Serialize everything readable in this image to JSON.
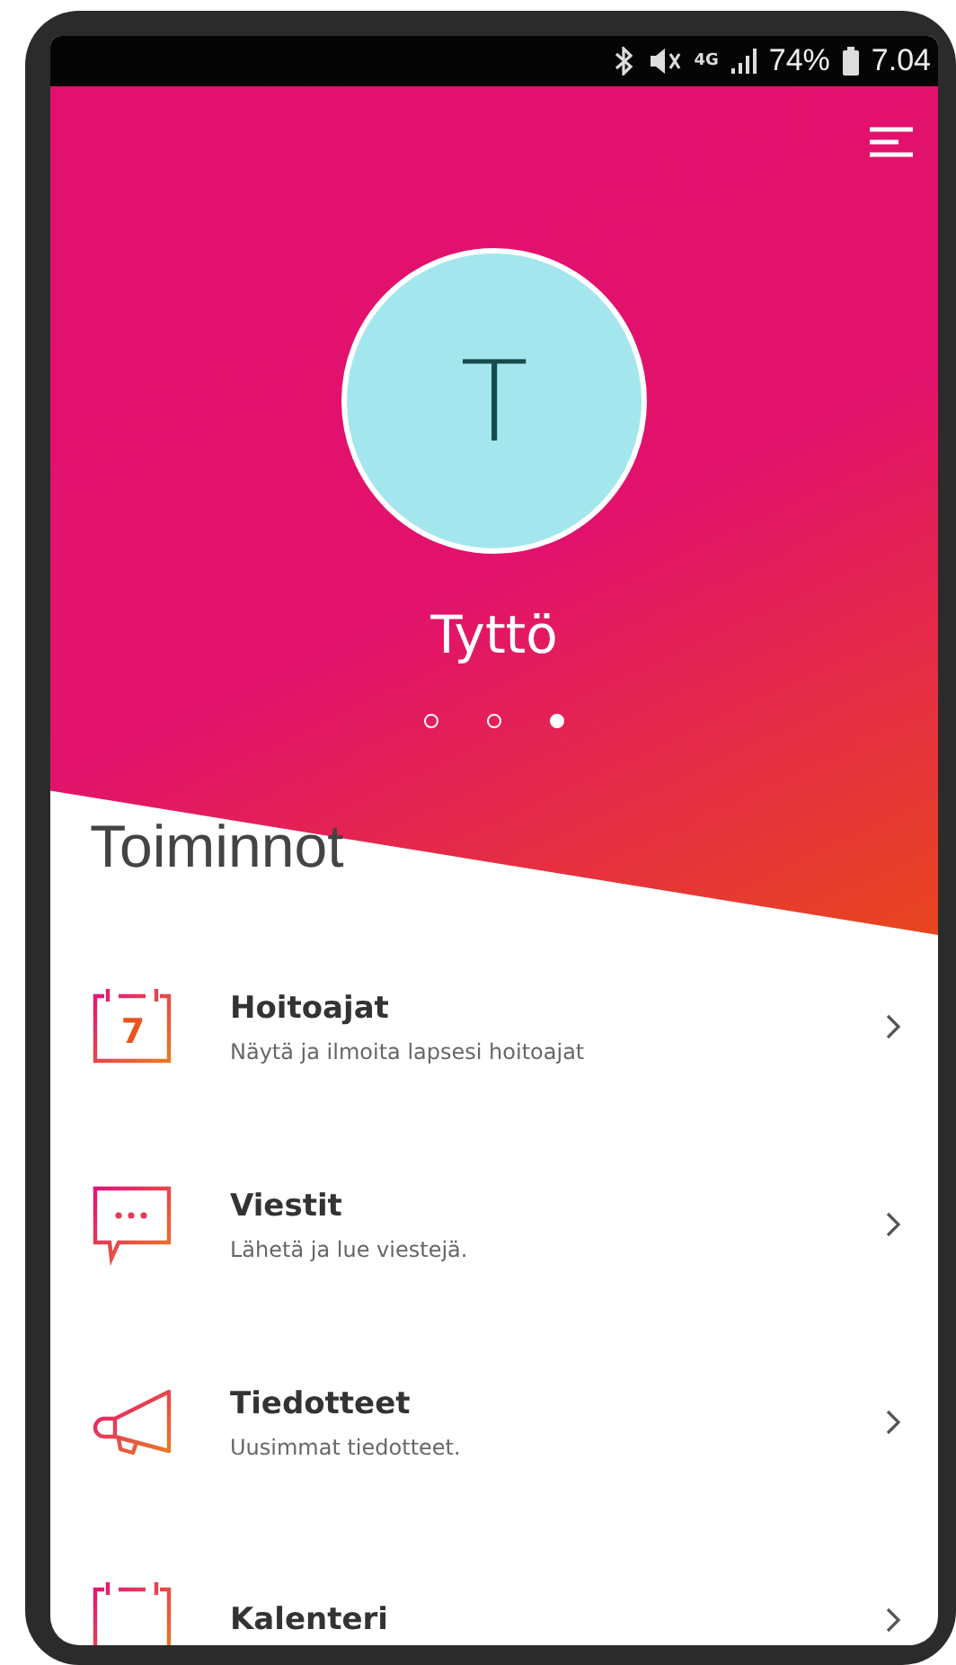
{
  "status_bar": {
    "network": "4G",
    "battery": "74%",
    "time": "7.04"
  },
  "profile": {
    "initial": "T",
    "name": "Tyttö"
  },
  "pager": [
    {
      "selected": false
    },
    {
      "selected": false
    },
    {
      "selected": true
    }
  ],
  "section_title": "Toiminnot",
  "actions": [
    {
      "kind": "calendar",
      "icon_label": "7",
      "title": "Hoitoajat",
      "description": "Näytä ja ilmoita lapsesi hoitoajat"
    },
    {
      "kind": "message",
      "title": "Viestit",
      "description": "Lähetä ja lue viestejä."
    },
    {
      "kind": "megaphone",
      "title": "Tiedotteet",
      "description": "Uusimmat tiedotteet."
    },
    {
      "kind": "calendar",
      "title": "Kalenteri"
    }
  ]
}
